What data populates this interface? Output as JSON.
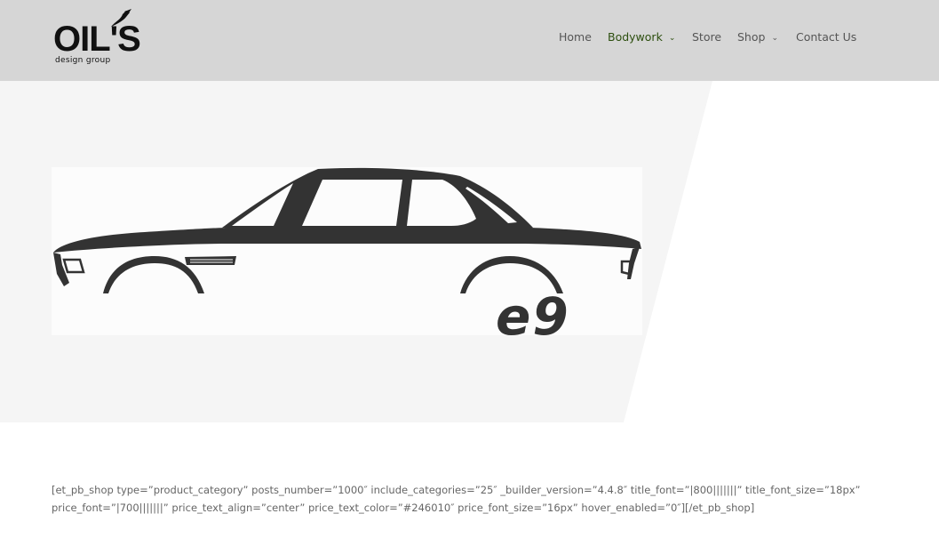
{
  "header": {
    "logo": {
      "main_text": "OIL'S",
      "sub_text": "design group"
    },
    "nav": {
      "items": [
        {
          "label": "Home",
          "has_dropdown": false,
          "active": false
        },
        {
          "label": "Bodywork",
          "has_dropdown": true,
          "active": true
        },
        {
          "label": "Store",
          "has_dropdown": false,
          "active": false
        },
        {
          "label": "Shop",
          "has_dropdown": true,
          "active": false
        },
        {
          "label": "Contact Us",
          "has_dropdown": false,
          "active": false
        }
      ]
    }
  },
  "hero": {
    "badge_text": "e9"
  },
  "content": {
    "shortcode_line1": "[et_pb_shop type=”product_category” posts_number=”1000″ include_categories=”25″ _builder_version=”4.4.8″ title_font=”|800|||||||” title_font_size=”18px”",
    "shortcode_line2": "price_font=”|700|||||||” price_text_align=”center” price_text_color=”#246010″ price_font_size=”16px” hover_enabled=”0″][/et_pb_shop]"
  },
  "colors": {
    "header_bg": "#d6d6d6",
    "nav_text": "#555555",
    "nav_active": "#2d4f0f",
    "hero_bg": "#f5f5f5",
    "car_silhouette": "#333333"
  }
}
